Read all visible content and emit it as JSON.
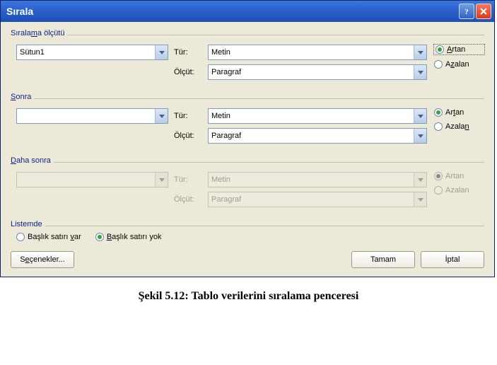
{
  "window": {
    "title": "Sırala"
  },
  "sections": {
    "criteria": {
      "legend": "Sıralama ölçütü",
      "column_value": "Sütun1",
      "type_label": "Tür:",
      "type_value": "Metin",
      "measure_label": "Ölçüt:",
      "measure_value": "Paragraf",
      "asc_label": "Artan",
      "desc_label": "Azalan"
    },
    "then": {
      "legend": "Sonra",
      "column_value": "",
      "type_label": "Tür:",
      "type_value": "Metin",
      "measure_label": "Ölçüt:",
      "measure_value": "Paragraf",
      "asc_label": "Artan",
      "desc_label": "Azalan"
    },
    "thenmore": {
      "legend": "Daha sonra",
      "column_value": "",
      "type_label": "Tür:",
      "type_value": "Metin",
      "measure_label": "Ölçüt:",
      "measure_value": "Paragraf",
      "asc_label": "Artan",
      "desc_label": "Azalan"
    },
    "listemde": {
      "legend": "Listemde",
      "has_header": "Başlık satırı var",
      "no_header": "Başlık satırı yok"
    }
  },
  "buttons": {
    "options": "Seçenekler...",
    "ok": "Tamam",
    "cancel": "İptal"
  },
  "caption": "Şekil 5.12: Tablo verilerini sıralama penceresi"
}
